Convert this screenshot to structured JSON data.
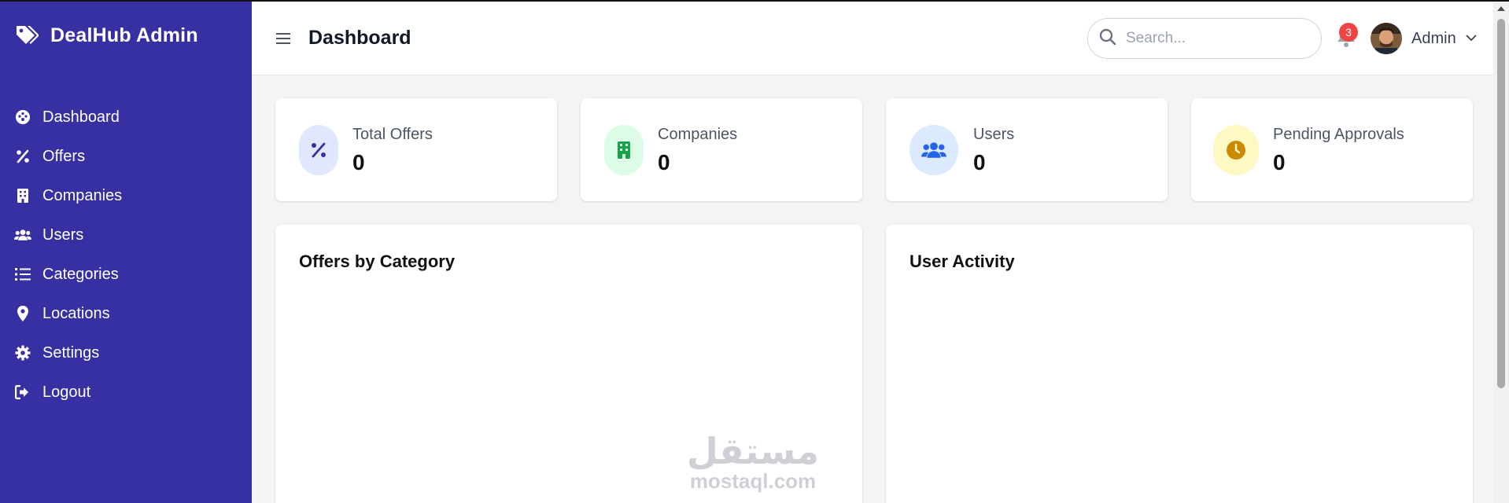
{
  "sidebar": {
    "brand": "DealHub Admin",
    "items": [
      {
        "label": "Dashboard",
        "icon": "palette-gauge-icon"
      },
      {
        "label": "Offers",
        "icon": "percent-icon"
      },
      {
        "label": "Companies",
        "icon": "building-icon"
      },
      {
        "label": "Users",
        "icon": "users-icon"
      },
      {
        "label": "Categories",
        "icon": "list-icon"
      },
      {
        "label": "Locations",
        "icon": "map-pin-icon"
      },
      {
        "label": "Settings",
        "icon": "gear-icon"
      },
      {
        "label": "Logout",
        "icon": "logout-icon"
      }
    ],
    "bg_color": "#3730a3"
  },
  "topbar": {
    "title": "Dashboard",
    "search_placeholder": "Search...",
    "notification_count": "3",
    "user_name": "Admin"
  },
  "stats": [
    {
      "label": "Total Offers",
      "value": "0",
      "icon": "percent-icon",
      "icon_bg": "#e0e7ff",
      "icon_color": "#3730a3"
    },
    {
      "label": "Companies",
      "value": "0",
      "icon": "building-icon",
      "icon_bg": "#dcfce7",
      "icon_color": "#16a34a"
    },
    {
      "label": "Users",
      "value": "0",
      "icon": "users-icon",
      "icon_bg": "#dbeafe",
      "icon_color": "#2563eb"
    },
    {
      "label": "Pending Approvals",
      "value": "0",
      "icon": "clock-icon",
      "icon_bg": "#fef9c3",
      "icon_color": "#ca8a04"
    }
  ],
  "panels": [
    {
      "title": "Offers by Category"
    },
    {
      "title": "User Activity"
    }
  ],
  "watermark": {
    "arabic": "مستقل",
    "latin": "mostaql.com"
  }
}
